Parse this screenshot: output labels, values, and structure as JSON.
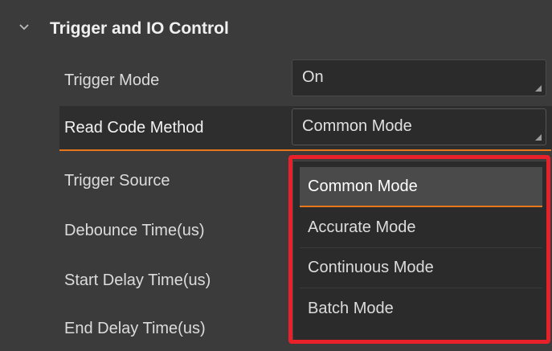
{
  "section": {
    "title": "Trigger and IO Control",
    "expanded": true
  },
  "rows": [
    {
      "label": "Trigger Mode"
    },
    {
      "label": "Read Code Method"
    },
    {
      "label": "Trigger Source"
    },
    {
      "label": "Debounce Time(us)"
    },
    {
      "label": "Start Delay Time(us)"
    },
    {
      "label": "End Delay Time(us)"
    }
  ],
  "fields": {
    "trigger_mode": "On",
    "read_code_method": "Common Mode"
  },
  "dropdown": {
    "options": [
      "Common Mode",
      "Accurate Mode",
      "Continuous Mode",
      "Batch Mode"
    ],
    "selected": "Common Mode"
  },
  "colors": {
    "background": "#3b3b3b",
    "field_bg": "#2b2b2b",
    "accent": "#e8771b",
    "highlight": "#e8202a"
  },
  "icons": {
    "section_toggle": "chevron-down-icon",
    "field_resize": "resize-corner-icon"
  }
}
